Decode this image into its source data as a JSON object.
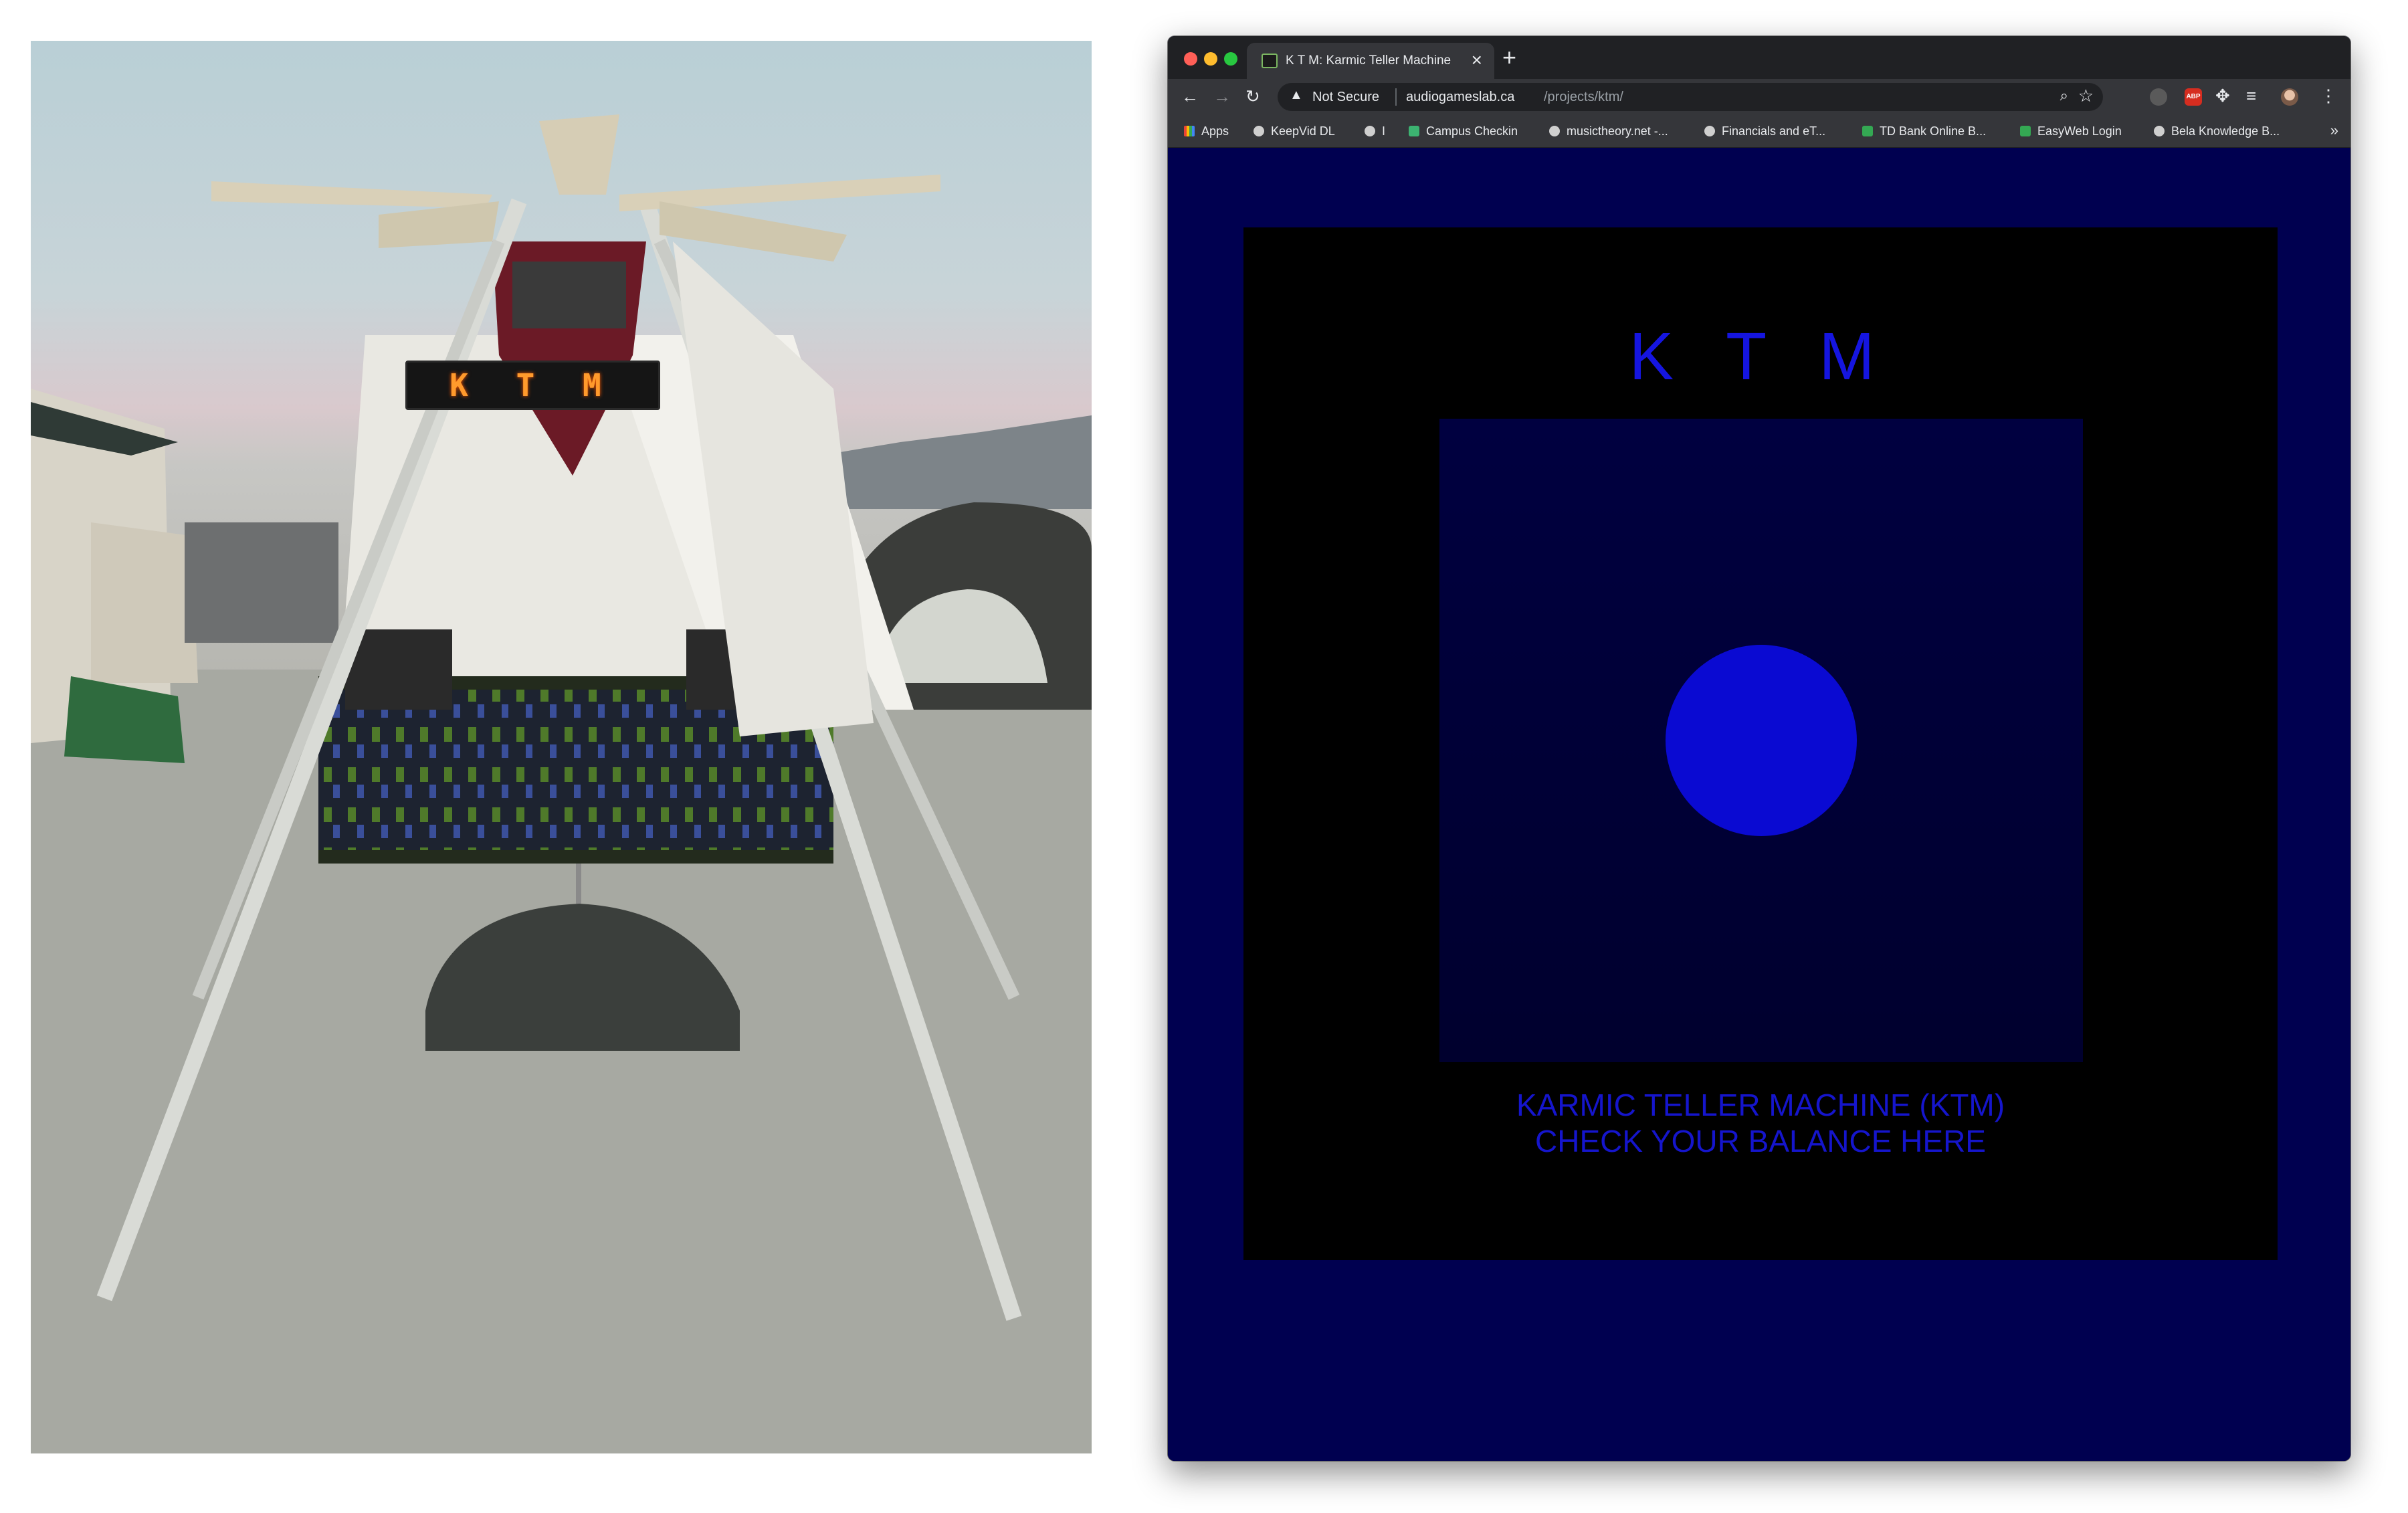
{
  "photo": {
    "sign_text": "K T M"
  },
  "browser": {
    "tab": {
      "title": "K T M: Karmic Teller Machine",
      "close_glyph": "×"
    },
    "new_tab_glyph": "+",
    "nav": {
      "back_glyph": "←",
      "forward_glyph": "→",
      "reload_glyph": "↻"
    },
    "omnibox": {
      "security_label": "Not Secure",
      "url_domain": "audiogameslab.ca",
      "url_path": "/projects/ktm/"
    },
    "extensions": {
      "abp_label": "ABP"
    },
    "menu_glyph": "⋮",
    "bookmarks": [
      {
        "label": "Apps",
        "icon": "apps-grid-icon"
      },
      {
        "label": "KeepVid DL",
        "icon": "globe-icon"
      },
      {
        "label": "I",
        "icon": "globe-icon"
      },
      {
        "label": "Campus Checkin",
        "icon": "campus-icon"
      },
      {
        "label": "musictheory.net -...",
        "icon": "musictheory-icon"
      },
      {
        "label": "Financials and eT...",
        "icon": "globe-icon"
      },
      {
        "label": "TD Bank Online B...",
        "icon": "td-icon"
      },
      {
        "label": "EasyWeb Login",
        "icon": "td-icon"
      },
      {
        "label": "Bela Knowledge B...",
        "icon": "globe-icon"
      }
    ],
    "bookmarks_more": "»"
  },
  "page": {
    "title": "K T M",
    "caption_line1": "KARMIC TELLER MACHINE (KTM)",
    "caption_line2": "CHECK YOUR BALANCE HERE"
  },
  "colors": {
    "page_background": "#000050",
    "panel": "#000000",
    "accent_blue": "#1515e0",
    "orb": "#0a0ad2"
  }
}
